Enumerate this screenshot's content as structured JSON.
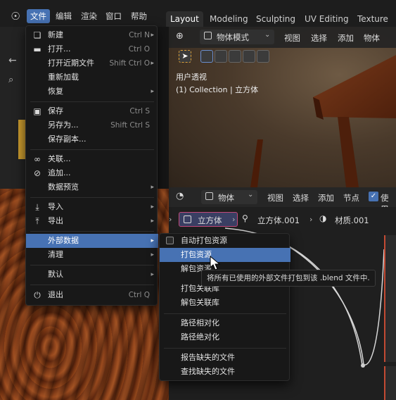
{
  "top_menu": [
    "文件",
    "编辑",
    "渲染",
    "窗口",
    "帮助"
  ],
  "workspace_tabs": [
    "Layout",
    "Modeling",
    "Sculpting",
    "UV Editing",
    "Texture Pa"
  ],
  "viewport": {
    "mode": "物体模式",
    "menu": [
      "视图",
      "选择",
      "添加",
      "物体"
    ],
    "perspective_label": "用户透视",
    "collection_label": "(1) Collection | 立方体"
  },
  "node_editor": {
    "object_dropdown": "物体",
    "menu": [
      "视图",
      "选择",
      "添加",
      "节点"
    ],
    "use_label": "使用",
    "breadcrumb": [
      "立方体",
      "立方体.001",
      "材质.001"
    ]
  },
  "file_menu": {
    "items": [
      {
        "label": "新建",
        "shortcut": "Ctrl N",
        "icon": "new-file-icon",
        "submenu": true
      },
      {
        "label": "打开...",
        "shortcut": "Ctrl O",
        "icon": "folder-open-icon"
      },
      {
        "label": "打开近期文件",
        "shortcut": "Shift Ctrl O",
        "submenu": true
      },
      {
        "label": "重新加载",
        "shortcut": ""
      },
      {
        "label": "恢复",
        "shortcut": "",
        "submenu": true
      },
      {
        "label": "保存",
        "shortcut": "Ctrl S",
        "icon": "save-icon"
      },
      {
        "label": "另存为...",
        "shortcut": "Shift Ctrl S"
      },
      {
        "label": "保存副本...",
        "shortcut": ""
      },
      {
        "label": "关联...",
        "shortcut": "",
        "icon": "link-icon"
      },
      {
        "label": "追加...",
        "shortcut": "",
        "icon": "append-icon"
      },
      {
        "label": "数据预览",
        "shortcut": "",
        "submenu": true
      },
      {
        "label": "导入",
        "shortcut": "",
        "icon": "import-icon",
        "submenu": true
      },
      {
        "label": "导出",
        "shortcut": "",
        "icon": "export-icon",
        "submenu": true
      },
      {
        "label": "外部数据",
        "shortcut": "",
        "submenu": true,
        "highlighted": true
      },
      {
        "label": "清理",
        "shortcut": "",
        "submenu": true
      },
      {
        "label": "默认",
        "shortcut": "",
        "submenu": true
      },
      {
        "label": "退出",
        "shortcut": "Ctrl Q",
        "icon": "power-icon"
      }
    ]
  },
  "external_data_submenu": {
    "items": [
      {
        "label": "自动打包资源",
        "checkbox": true
      },
      {
        "label": "打包资源",
        "highlighted": true
      },
      {
        "label": "解包资源"
      },
      {
        "label": "打包关联库"
      },
      {
        "label": "解包关联库"
      },
      {
        "label": "路径相对化"
      },
      {
        "label": "路径绝对化"
      },
      {
        "label": "报告缺失的文件"
      },
      {
        "label": "查找缺失的文件"
      }
    ]
  },
  "tooltip": "将所有已使用的外部文件打包到该 .blend 文件中.",
  "colors": {
    "accent": "#4772b3",
    "menu_bg": "#181818"
  }
}
